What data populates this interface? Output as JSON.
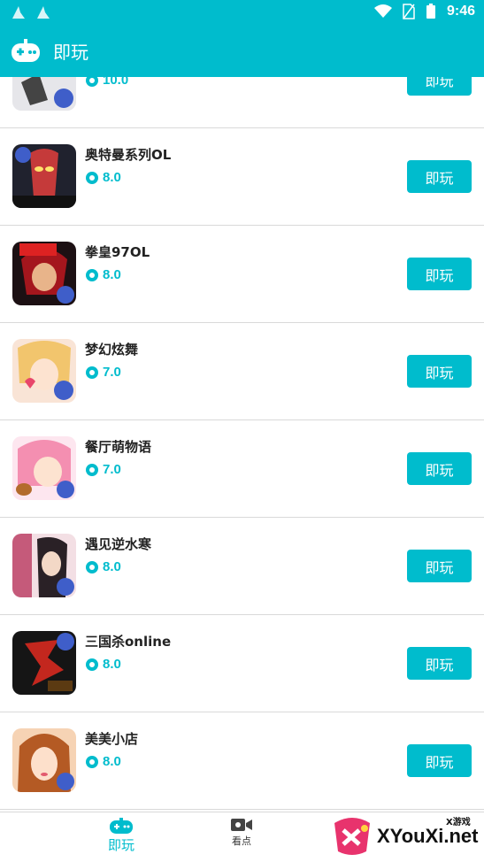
{
  "status_bar": {
    "time": "9:46"
  },
  "header": {
    "title": "即玩"
  },
  "colors": {
    "accent": "#00bccd",
    "divider": "#d9d9d9"
  },
  "games": [
    {
      "name": "",
      "rating": "10.0",
      "play_label": "即玩"
    },
    {
      "name": "奥特曼系列OL",
      "rating": "8.0",
      "play_label": "即玩"
    },
    {
      "name": "拳皇97OL",
      "rating": "8.0",
      "play_label": "即玩"
    },
    {
      "name": "梦幻炫舞",
      "rating": "7.0",
      "play_label": "即玩"
    },
    {
      "name": "餐厅萌物语",
      "rating": "7.0",
      "play_label": "即玩"
    },
    {
      "name": "遇见逆水寒",
      "rating": "8.0",
      "play_label": "即玩"
    },
    {
      "name": "三国杀online",
      "rating": "8.0",
      "play_label": "即玩"
    },
    {
      "name": "美美小店",
      "rating": "8.0",
      "play_label": "即玩"
    }
  ],
  "bottom_nav": {
    "play_label": "即玩",
    "watch_label": "看点"
  },
  "watermark": {
    "small": "X游戏",
    "big": "XYouXi.net"
  }
}
